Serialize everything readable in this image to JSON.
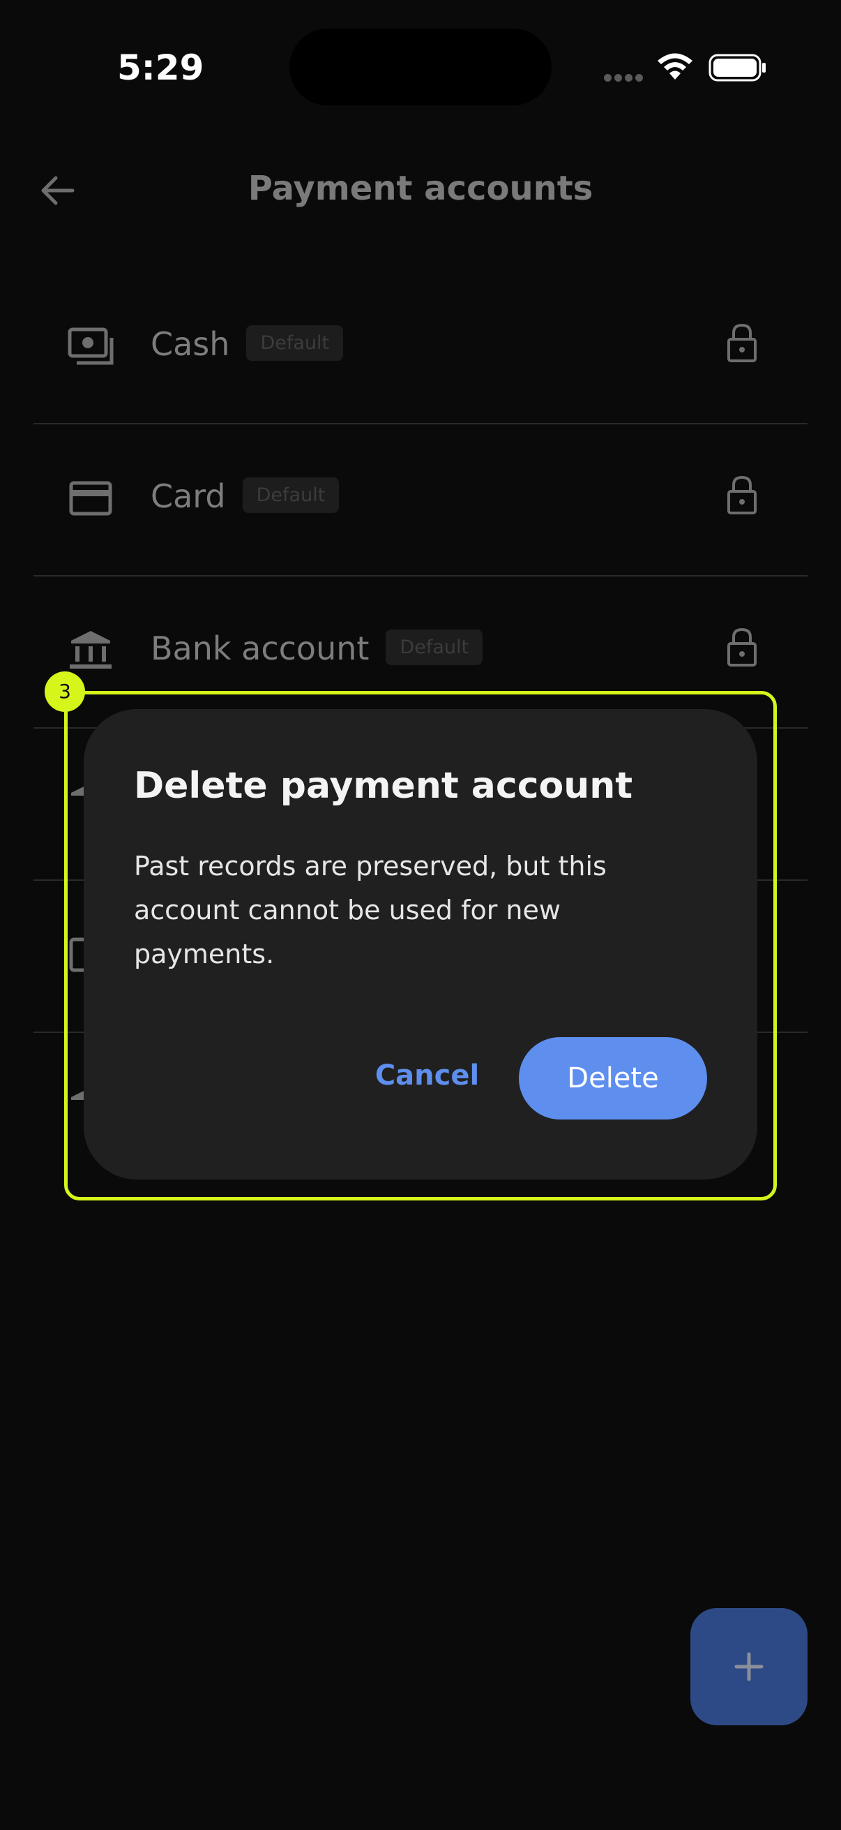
{
  "status_bar": {
    "time": "5:29"
  },
  "header": {
    "title": "Payment accounts",
    "back_icon": "arrow-left-icon"
  },
  "accounts": [
    {
      "label": "Cash",
      "badge": "Default",
      "icon": "cash-icon",
      "locked": true
    },
    {
      "label": "Card",
      "badge": "Default",
      "icon": "card-icon",
      "locked": true
    },
    {
      "label": "Bank account",
      "badge": "Default",
      "icon": "bank-icon",
      "locked": true
    }
  ],
  "dialog": {
    "title": "Delete payment account",
    "message": "Past records are preserved, but this account cannot be used for new payments.",
    "cancel_label": "Cancel",
    "delete_label": "Delete"
  },
  "highlight": {
    "badge": "3"
  },
  "fab": {
    "icon": "plus-icon"
  },
  "colors": {
    "background": "#0a0a0a",
    "dialog_background": "#202020",
    "accent": "#5e8fee",
    "highlight": "#d6f51b",
    "fab": "#2e4a86"
  }
}
